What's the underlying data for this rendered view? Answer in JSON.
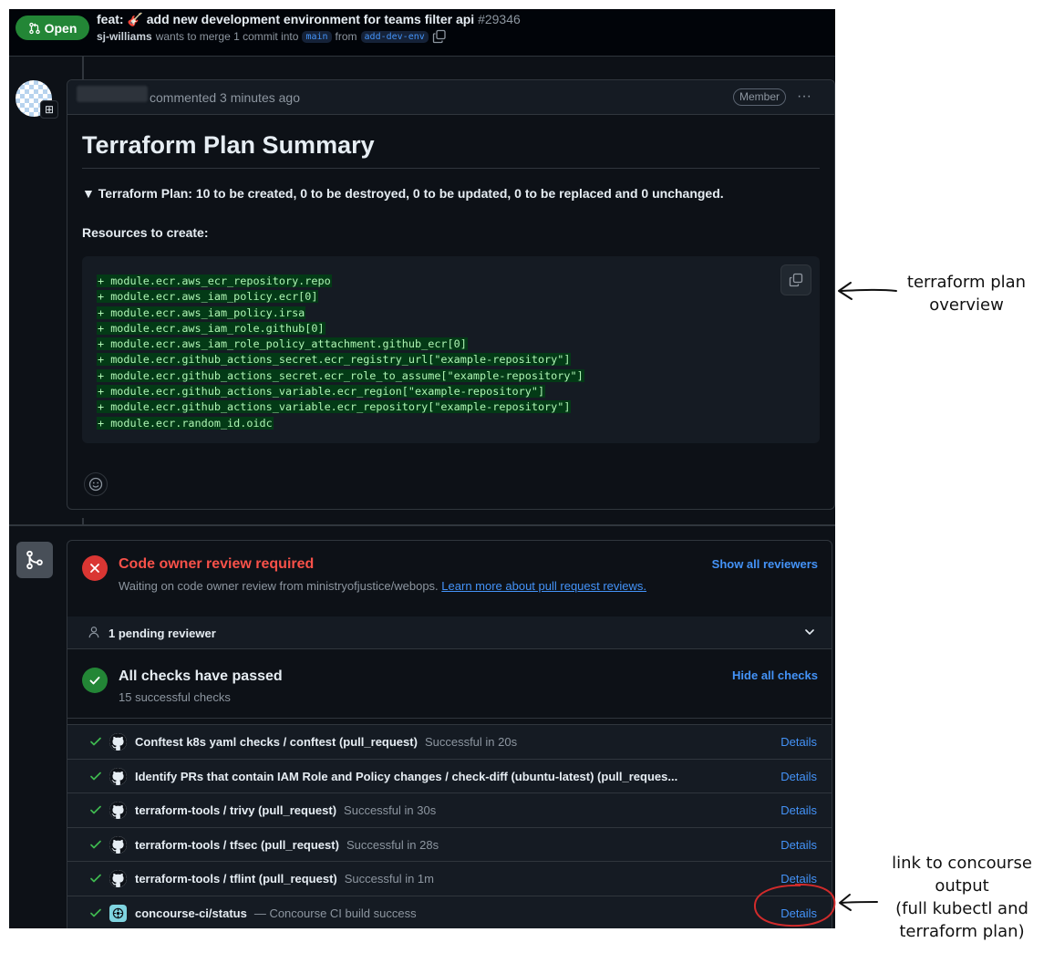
{
  "pr": {
    "state": "Open",
    "title": "feat: 🎸 add new development environment for teams filter api",
    "number": "#29346",
    "author": "sj-williams",
    "merge_text": "wants to merge 1 commit into",
    "base_branch": "main",
    "from_text": "from",
    "head_branch": "add-dev-env"
  },
  "comment": {
    "meta": "commented 3 minutes ago",
    "role_badge": "Member",
    "heading": "Terraform Plan Summary",
    "summary": "▼ Terraform Plan: 10 to be created, 0 to be destroyed, 0 to be updated, 0 to be replaced and 0 unchanged.",
    "resources_heading": "Resources to create:",
    "resources": [
      "+ module.ecr.aws_ecr_repository.repo",
      "+ module.ecr.aws_iam_policy.ecr[0]",
      "+ module.ecr.aws_iam_policy.irsa",
      "+ module.ecr.aws_iam_role.github[0]",
      "+ module.ecr.aws_iam_role_policy_attachment.github_ecr[0]",
      "+ module.ecr.github_actions_secret.ecr_registry_url[\"example-repository\"]",
      "+ module.ecr.github_actions_secret.ecr_role_to_assume[\"example-repository\"]",
      "+ module.ecr.github_actions_variable.ecr_region[\"example-repository\"]",
      "+ module.ecr.github_actions_variable.ecr_repository[\"example-repository\"]",
      "+ module.ecr.random_id.oidc"
    ]
  },
  "merge_box": {
    "code_owner": {
      "title": "Code owner review required",
      "subtitle": "Waiting on code owner review from ministryofjustice/webops.",
      "link": "Learn more about pull request reviews.",
      "action": "Show all reviewers"
    },
    "pending": "1 pending reviewer",
    "checks": {
      "title": "All checks have passed",
      "subtitle": "15 successful checks",
      "action": "Hide all checks",
      "items": [
        {
          "name": "Conftest k8s yaml checks / conftest (pull_request)",
          "status": "Successful in 20s",
          "link": "Details"
        },
        {
          "name": "Identify PRs that contain IAM Role and Policy changes / check-diff (ubuntu-latest) (pull_reques...",
          "status": "",
          "link": "Details"
        },
        {
          "name": "terraform-tools / trivy (pull_request)",
          "status": "Successful in 30s",
          "link": "Details"
        },
        {
          "name": "terraform-tools / tfsec (pull_request)",
          "status": "Successful in 28s",
          "link": "Details"
        },
        {
          "name": "terraform-tools / tflint (pull_request)",
          "status": "Successful in 1m",
          "link": "Details"
        },
        {
          "name": "concourse-ci/status",
          "status": "— Concourse CI build success",
          "link": "Details"
        }
      ]
    }
  },
  "annotations": {
    "plan": [
      "terraform plan",
      "overview"
    ],
    "concourse": [
      "link to concourse",
      "output",
      "(full kubectl and",
      "terraform plan)"
    ]
  },
  "colors": {
    "background": "#0d1117",
    "accent_blue": "#4493f8",
    "success_green": "#238636",
    "danger_red": "#da3633",
    "annotation_circle": "#d12b2b"
  }
}
